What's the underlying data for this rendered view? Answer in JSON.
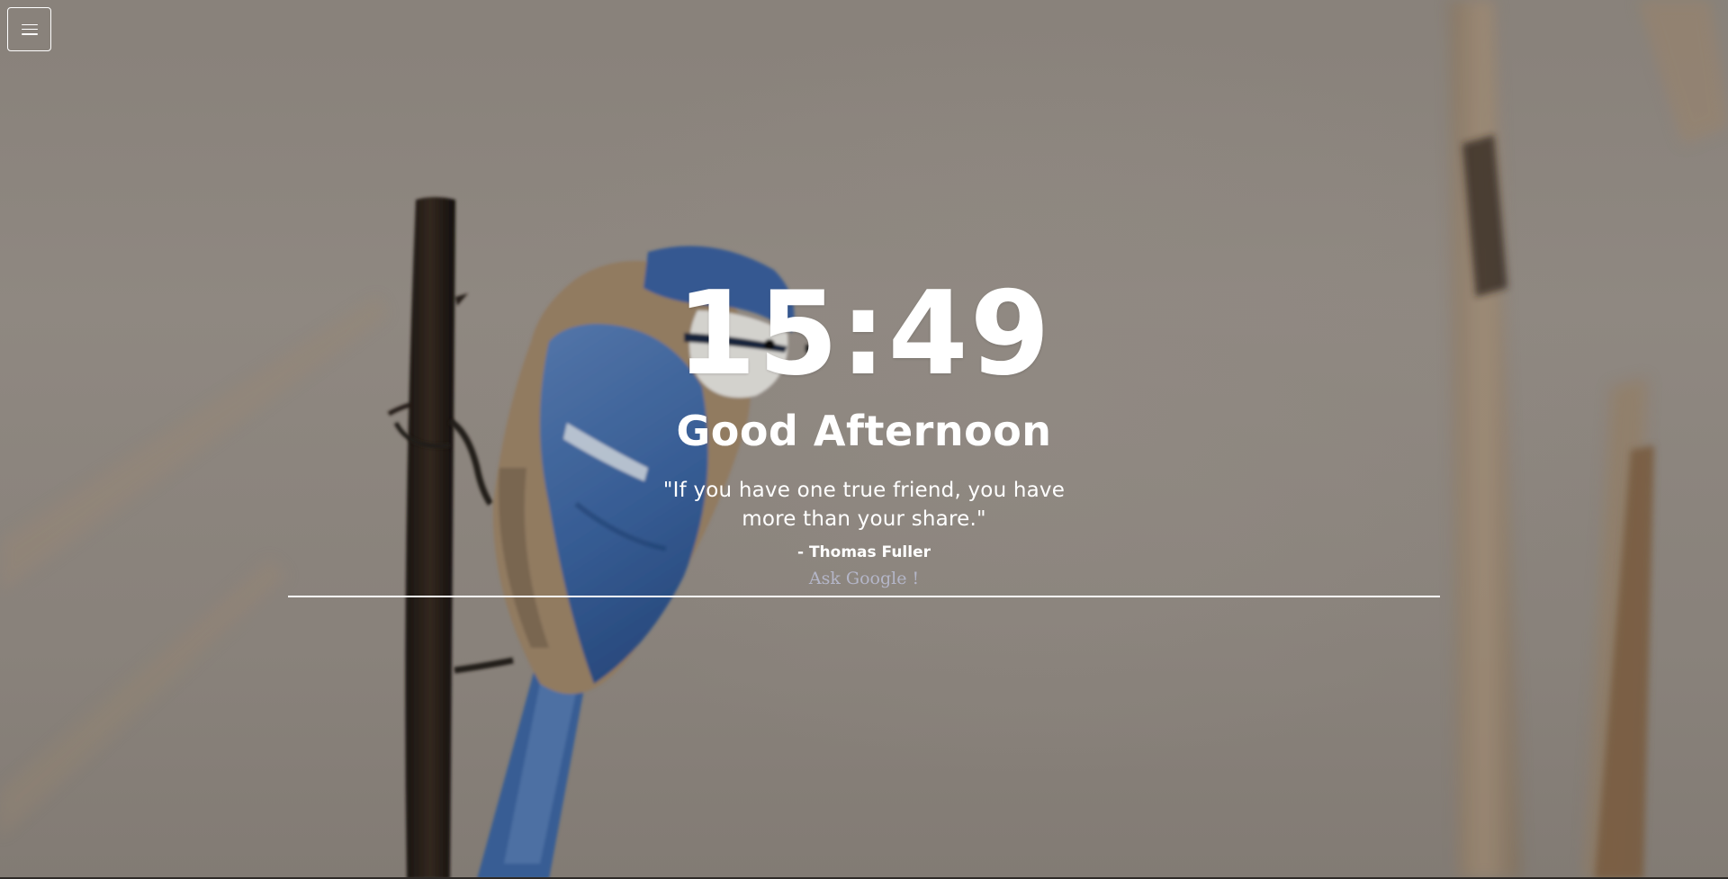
{
  "clock": {
    "time": "15:49"
  },
  "greeting": {
    "text": "Good Afternoon"
  },
  "quote": {
    "text": "\"If you have one true friend, you have more than your share.\"",
    "author": "- Thomas Fuller"
  },
  "search": {
    "placeholder": "Ask Google !",
    "value": ""
  },
  "menu": {
    "icon": "hamburger-menu-icon"
  },
  "colors": {
    "text": "#ffffff",
    "placeholder": "#b4b6c8",
    "background": "#9c948c"
  }
}
